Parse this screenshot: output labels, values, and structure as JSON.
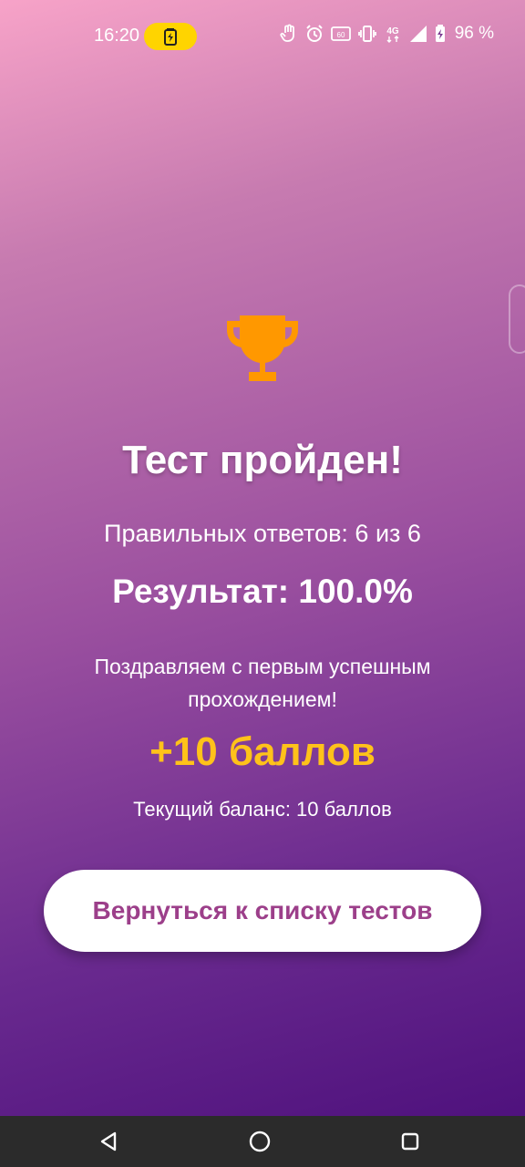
{
  "status_bar": {
    "time": "16:20",
    "battery_percent": "96 %",
    "icons": [
      "battery-saver-icon",
      "hand-icon",
      "alarm-icon",
      "hd-voice-icon",
      "vibrate-icon",
      "4g-icon",
      "signal-icon",
      "battery-icon"
    ]
  },
  "result_screen": {
    "title": "Тест пройден!",
    "correct_answers": "Правильных ответов: 6 из 6",
    "result": "Результат: 100.0%",
    "congrats": "Поздравляем с первым успешным прохождением!",
    "points_awarded": "+10 баллов",
    "current_balance": "Текущий баланс: 10 баллов",
    "back_button_label": "Вернуться к списку тестов",
    "trophy_icon": "trophy-icon"
  },
  "colors": {
    "trophy": "#ff9800",
    "points": "#ffc21a",
    "button_text": "#9c3f8a",
    "gradient_start": "#f7a3c8",
    "gradient_end": "#4a0d7a"
  },
  "nav_bar": {
    "buttons": [
      "back-icon",
      "home-icon",
      "recents-icon"
    ]
  }
}
